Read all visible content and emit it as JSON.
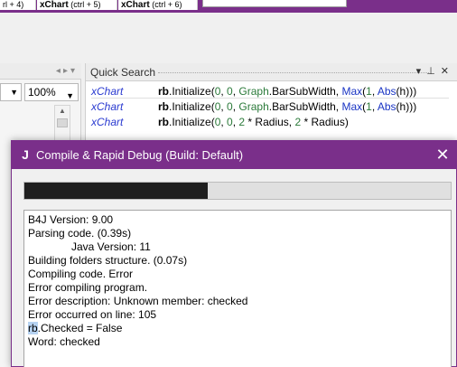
{
  "top_tabs": [
    {
      "name": "",
      "shortcut": "rl + 4)"
    },
    {
      "name": "xChart",
      "shortcut": "(ctrl + 5)"
    },
    {
      "name": "xChart",
      "shortcut": "(ctrl + 6)"
    }
  ],
  "left_pane": {
    "zoom_value": "100%"
  },
  "quick_search": {
    "title": "Quick Search",
    "rows": [
      {
        "module": "xChart",
        "obj": "rb",
        "text_a": ".Initialize(",
        "n1": "0",
        "sep1": ", ",
        "n2": "0",
        "sep2": ", ",
        "graph": "Graph",
        "text_b": ".BarSubWidth, ",
        "max": "Max",
        "text_c": "(",
        "n3": "1",
        "sep3": ", ",
        "abs": "Abs",
        "text_d": "(h)))"
      },
      {
        "module": "xChart",
        "obj": "rb",
        "text_a": ".Initialize(",
        "n1": "0",
        "sep1": ", ",
        "n2": "0",
        "sep2": ", ",
        "graph": "Graph",
        "text_b": ".BarSubWidth, ",
        "max": "Max",
        "text_c": "(",
        "n3": "1",
        "sep3": ", ",
        "abs": "Abs",
        "text_d": "(h)))"
      },
      {
        "module": "xChart",
        "obj": "rb",
        "text_a": ".Initialize(",
        "n1": "0",
        "sep1": ", ",
        "n2": "0",
        "sep2": ", ",
        "n4": "2",
        "text_e": " * Radius, ",
        "n5": "2",
        "text_f": " * Radius)"
      }
    ]
  },
  "dialog": {
    "icon_letter": "J",
    "title": "Compile & Rapid Debug (Build: Default)",
    "close_glyph": "✕",
    "progress_fraction": 0.43,
    "log_lines": [
      "B4J Version: 9.00",
      "Parsing code.    (0.39s)",
      "Java Version: 11",
      "Building folders structure.    (0.07s)",
      "Compiling code.    Error",
      "Error compiling program.",
      "Error description: Unknown member: checked",
      "Error occurred on line: 105",
      ".Checked = False",
      "Word: checked"
    ],
    "highlight_prefix": "rb"
  },
  "colors": {
    "accent": "#7a2f8a",
    "progress_fill": "#1f1f1f",
    "module_text": "#2a3ad0",
    "number_text": "#2b7a3a",
    "keyword_text": "#1a35c4",
    "selection": "#b7d3f2"
  },
  "icons": {
    "close": "close-icon",
    "app": "b4j-app-icon",
    "pin": "pin-icon",
    "dropdown": "chevron-down-icon",
    "scroll_up": "scroll-up-icon",
    "nav_left": "chevron-left-icon",
    "nav_right": "chevron-right-icon"
  }
}
